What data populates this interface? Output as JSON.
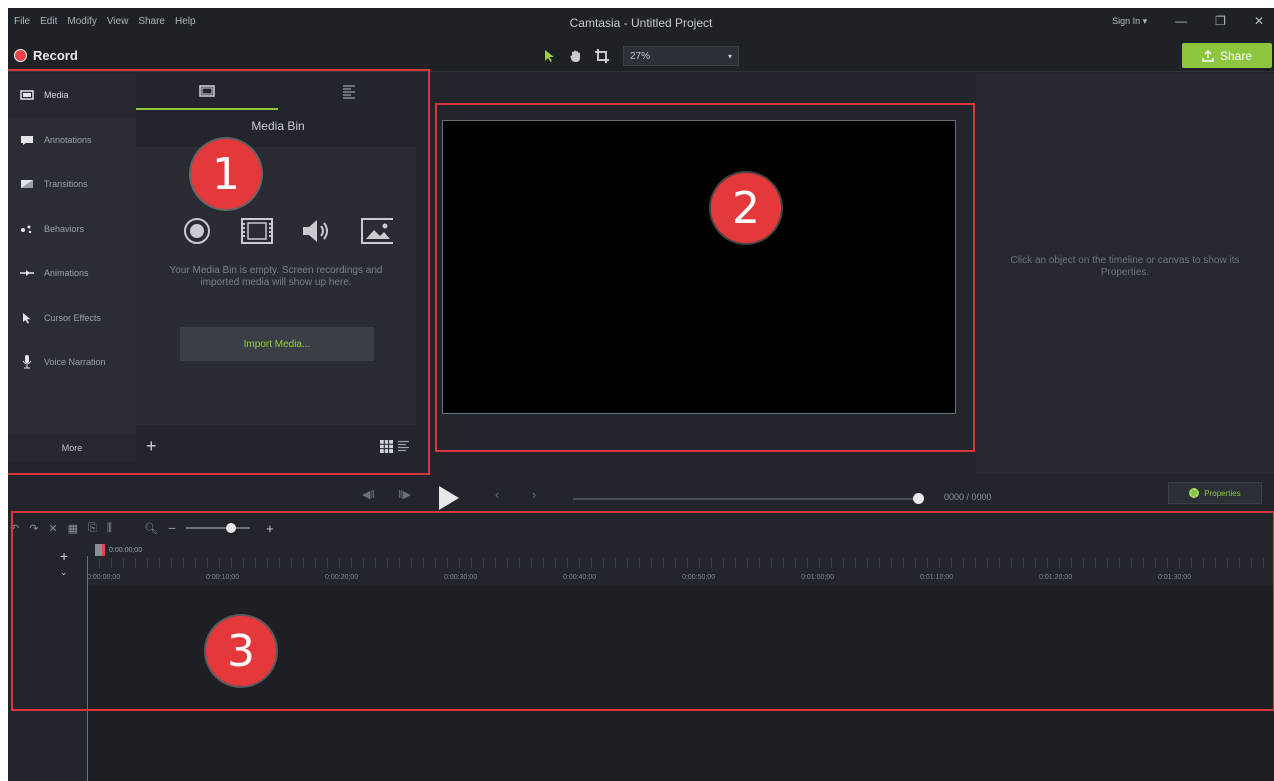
{
  "app": {
    "title": "Camtasia - Untitled Project",
    "menu": [
      "File",
      "Edit",
      "Modify",
      "View",
      "Share",
      "Help"
    ],
    "sign_in": "Sign In ▾",
    "window_controls": {
      "minimize": "—",
      "restore": "❐",
      "close": "✕"
    }
  },
  "toolbar": {
    "record_label": "Record",
    "zoom_value": "27%",
    "share_label": "Share",
    "icons": [
      "select-arrow-icon",
      "pan-hand-icon",
      "crop-icon"
    ]
  },
  "sidebar": {
    "items": [
      {
        "label": "Media",
        "icon": "media-icon"
      },
      {
        "label": "Annotations",
        "icon": "annotations-icon"
      },
      {
        "label": "Transitions",
        "icon": "transitions-icon"
      },
      {
        "label": "Behaviors",
        "icon": "behaviors-icon"
      },
      {
        "label": "Animations",
        "icon": "animations-icon"
      },
      {
        "label": "Cursor Effects",
        "icon": "cursor-effects-icon"
      },
      {
        "label": "Voice Narration",
        "icon": "voice-narration-icon"
      }
    ],
    "more_label": "More"
  },
  "media_bin": {
    "title": "Media Bin",
    "empty_text": "Your Media Bin is empty. Screen recordings and imported media will show up here.",
    "import_label": "Import Media..."
  },
  "properties": {
    "hint": "Click an object on the timeline or canvas to show its Properties.",
    "button_label": "Properties"
  },
  "playback": {
    "time": "0000 / 0000"
  },
  "timeline": {
    "playhead_time": "0:00:00;00",
    "ticks": [
      "0:00:00;00",
      "0:00:10;00",
      "0:00:20;00",
      "0:00:30;00",
      "0:00:40;00",
      "0:00:50;00",
      "0:01:00;00",
      "0:01:10;00",
      "0:01:20;00",
      "0:01:30;00"
    ]
  },
  "callouts": [
    "1",
    "2",
    "3"
  ],
  "colors": {
    "accent": "#8cc63f",
    "highlight": "#d9363e",
    "record": "#e8444a"
  }
}
